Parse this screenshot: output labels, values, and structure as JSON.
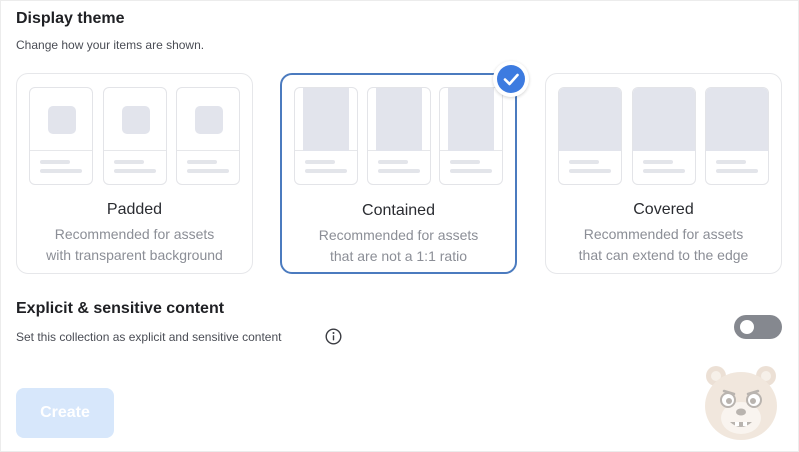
{
  "display_theme": {
    "title": "Display theme",
    "subtitle": "Change how your items are shown.",
    "options": [
      {
        "label": "Padded",
        "desc_line1": "Recommended for assets",
        "desc_line2": "with transparent background",
        "selected": false
      },
      {
        "label": "Contained",
        "desc_line1": "Recommended for assets",
        "desc_line2": "that are not a 1:1 ratio",
        "selected": true
      },
      {
        "label": "Covered",
        "desc_line1": "Recommended for assets",
        "desc_line2": "that can extend to the edge",
        "selected": false
      }
    ]
  },
  "explicit": {
    "title": "Explicit & sensitive content",
    "subtitle": "Set this collection as explicit and sensitive content",
    "toggle_on": false
  },
  "actions": {
    "create_label": "Create"
  },
  "colors": {
    "accent": "#3d7be0",
    "selected_border": "#4b7bbf",
    "create_bg": "#d7e7fb",
    "toggle_off": "#85888f"
  },
  "icons": {
    "check": "check-icon",
    "info": "info-icon",
    "mascot": "bear-mascot-icon"
  }
}
